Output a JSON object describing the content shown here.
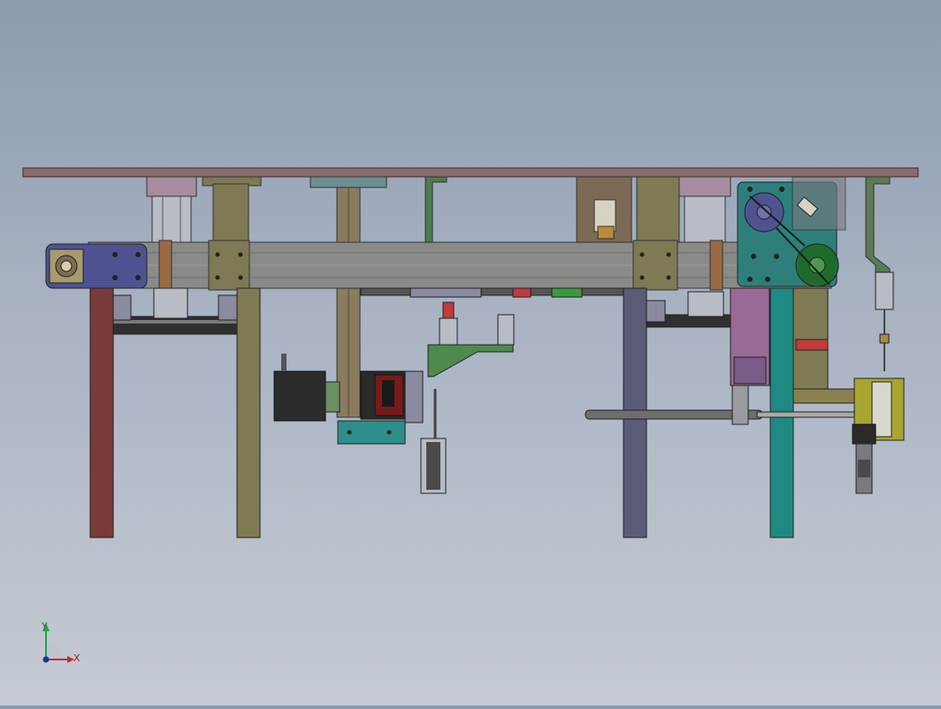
{
  "view": {
    "triad": {
      "y_label": "Y",
      "x_label": "X"
    }
  },
  "colors": {
    "background_top": "#8c9bb0",
    "background_bottom": "#c6cbd4",
    "table_top": "#8a6c6c",
    "leg_red": "#7a3b3a",
    "leg_olive": "#7d7a54",
    "leg_slate": "#5b5c78",
    "leg_teal": "#1e8a82",
    "beam": "#8a8a88",
    "end_plate": "#4e5290",
    "gearbox": "#2e7f7c",
    "motor": "#2c2c2c",
    "cylinder_yellow": "#a9a531"
  }
}
